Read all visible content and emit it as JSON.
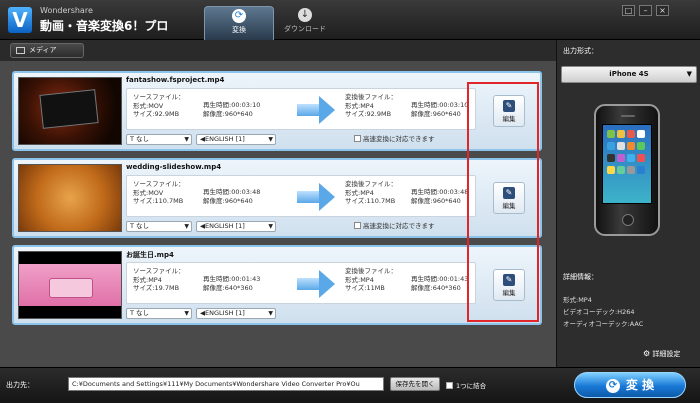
{
  "app": {
    "brand_small": "Wondershare",
    "brand_big": "動画・音楽変換6！プロ",
    "logo_letter": "V"
  },
  "tabs": [
    {
      "label": "変換",
      "icon": "refresh-icon",
      "active": true
    },
    {
      "label": "ダウンロード",
      "icon": "download-icon",
      "active": false
    }
  ],
  "window_buttons": [
    "□",
    "–",
    "×"
  ],
  "toolbar": {
    "media_label": "メディア"
  },
  "files": [
    {
      "name": "fantashow.fsproject.mp4",
      "source": {
        "heading": "ソースファイル：",
        "format": "形式:MOV",
        "size": "サイズ:92.9MB",
        "duration": "再生時間:00:03:10",
        "resolution": "解像度:960*640"
      },
      "target": {
        "heading": "変換後ファイル：",
        "format": "形式:MP4",
        "size": "サイズ:92.9MB",
        "duration": "再生時間:00:03:10",
        "resolution": "解像度:960*640"
      },
      "subtitle": "なし",
      "audio": "ENGLISH [1]",
      "highspeed": "高速変換に対応できます",
      "edit_label": "編集"
    },
    {
      "name": "wedding-slideshow.mp4",
      "source": {
        "heading": "ソースファイル：",
        "format": "形式:MOV",
        "size": "サイズ:110.7MB",
        "duration": "再生時間:00:03:48",
        "resolution": "解像度:960*640"
      },
      "target": {
        "heading": "変換後ファイル：",
        "format": "形式:MP4",
        "size": "サイズ:110.7MB",
        "duration": "再生時間:00:03:48",
        "resolution": "解像度:960*640"
      },
      "subtitle": "なし",
      "audio": "ENGLISH [1]",
      "highspeed": "高速変換に対応できます",
      "edit_label": "編集"
    },
    {
      "name": "お誕生日.mp4",
      "source": {
        "heading": "ソースファイル：",
        "format": "形式:MP4",
        "size": "サイズ:19.7MB",
        "duration": "再生時間:00:01:43",
        "resolution": "解像度:640*360"
      },
      "target": {
        "heading": "変換後ファイル：",
        "format": "形式:MP4",
        "size": "サイズ:11MB",
        "duration": "再生時間:00:01:43",
        "resolution": "解像度:640*360"
      },
      "subtitle": "なし",
      "audio": "ENGLISH [1]",
      "highspeed": "",
      "edit_label": "編集"
    }
  ],
  "right_panel": {
    "title": "出力形式：",
    "format": "iPhone 4S",
    "detail_title": "詳細情報：",
    "details": [
      "形式:MP4",
      "ビデオコーデック:H264",
      "オーディオコーデック:AAC"
    ],
    "settings_label": "詳細設定"
  },
  "bottom": {
    "output_label": "出力先：",
    "path": "C:¥Documents and Settings¥111¥My Documents¥Wondershare Video Converter Pro¥Ou",
    "open_button": "保存先を開く",
    "merge_label": "1つに結合",
    "convert_label": "変 換"
  },
  "colors": {
    "accent": "#1878d6",
    "highlight_box": "#e0262b",
    "item_border": "#8cc3ea"
  }
}
